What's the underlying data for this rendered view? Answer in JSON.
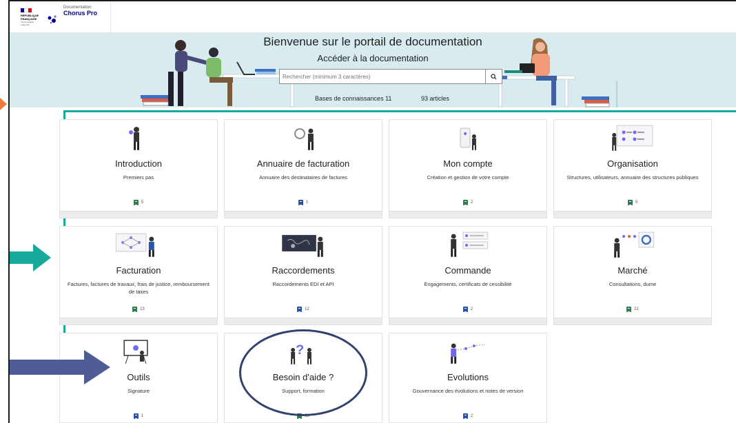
{
  "header": {
    "gov_name": "RÉPUBLIQUE FRANÇAISE",
    "gov_motto": "Liberté Égalité Fraternité",
    "brand_small": "Documentation",
    "brand_big": "Chorus Pro"
  },
  "hero": {
    "title": "Bienvenue sur le portail de documentation",
    "subtitle": "Accéder à la documentation",
    "search_placeholder": "Rechercher (minimum 3 caractères)",
    "knowledge_bases": "Bases de connaissances 11",
    "articles": "93 articles"
  },
  "cards": [
    {
      "title": "Introduction",
      "desc": "Premiers pas",
      "count": "5",
      "icon": "person-icon",
      "color": "green"
    },
    {
      "title": "Annuaire de facturation",
      "desc": "Annuaire des destinataires de factures",
      "count": "1",
      "icon": "magnifier-person-icon",
      "color": "blue"
    },
    {
      "title": "Mon compte",
      "desc": "Création et gestion de votre compte",
      "count": "2",
      "icon": "phone-person-icon",
      "color": "green"
    },
    {
      "title": "Organisation",
      "desc": "Structures, utilisateurs, annuaire des structures publiques",
      "count": "5",
      "icon": "org-chart-icon",
      "color": "green"
    },
    {
      "title": "Facturation",
      "desc": "Factures, factures de travaux, frais de justice, remboursement de taxes",
      "count": "13",
      "icon": "flow-icon",
      "color": "green"
    },
    {
      "title": "Raccordements",
      "desc": "Raccordements EDI et API",
      "count": "12",
      "icon": "map-screen-icon",
      "color": "blue"
    },
    {
      "title": "Commande",
      "desc": "Engagements, certificats de cessibilité",
      "count": "2",
      "icon": "cards-person-icon",
      "color": "blue"
    },
    {
      "title": "Marché",
      "desc": "Consultations, dume",
      "count": "22",
      "icon": "dashboard-icon",
      "color": "green"
    },
    {
      "title": "Outils",
      "desc": "Signature",
      "count": "1",
      "icon": "board-icon",
      "color": "blue"
    },
    {
      "title": "Besoin d'aide ?",
      "desc": "Support, formation",
      "count": "28",
      "icon": "question-icon",
      "color": "green"
    },
    {
      "title": "Evolutions",
      "desc": "Gouvernance des évolutions et notes de version",
      "count": "2",
      "icon": "path-icon",
      "color": "blue"
    }
  ],
  "colors": {
    "hero_bg": "#d8ecf0",
    "annotation_green": "#17a99a",
    "annotation_navy": "#33416e",
    "arrow_blue": "#4f5d96",
    "brand": "#000091"
  }
}
